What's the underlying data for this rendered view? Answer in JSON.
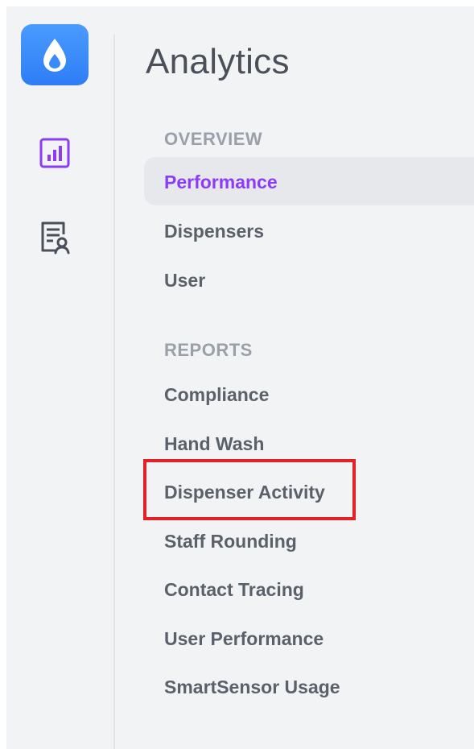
{
  "app": {
    "accent_color": "#8b3cf7",
    "logo_color": "#2f7df5"
  },
  "rail": {
    "logo_icon": "water-drop-icon",
    "items": [
      {
        "name": "analytics",
        "icon": "bar-chart-icon",
        "active": true
      },
      {
        "name": "reports",
        "icon": "certificate-report-icon",
        "active": false
      }
    ]
  },
  "panel": {
    "title": "Analytics",
    "sections": [
      {
        "label": "OVERVIEW",
        "items": [
          {
            "label": "Performance",
            "active": true
          },
          {
            "label": "Dispensers",
            "active": false
          },
          {
            "label": "User",
            "active": false
          }
        ]
      },
      {
        "label": "REPORTS",
        "items": [
          {
            "label": "Compliance",
            "active": false
          },
          {
            "label": "Hand Wash",
            "active": false
          },
          {
            "label": "Dispenser Activity",
            "active": false,
            "highlighted": true
          },
          {
            "label": "Staff Rounding",
            "active": false
          },
          {
            "label": "Contact Tracing",
            "active": false
          },
          {
            "label": "User Performance",
            "active": false
          },
          {
            "label": "SmartSensor Usage",
            "active": false
          }
        ]
      }
    ]
  },
  "annotation": {
    "highlight_color": "#e32026",
    "target": "Dispenser Activity"
  }
}
